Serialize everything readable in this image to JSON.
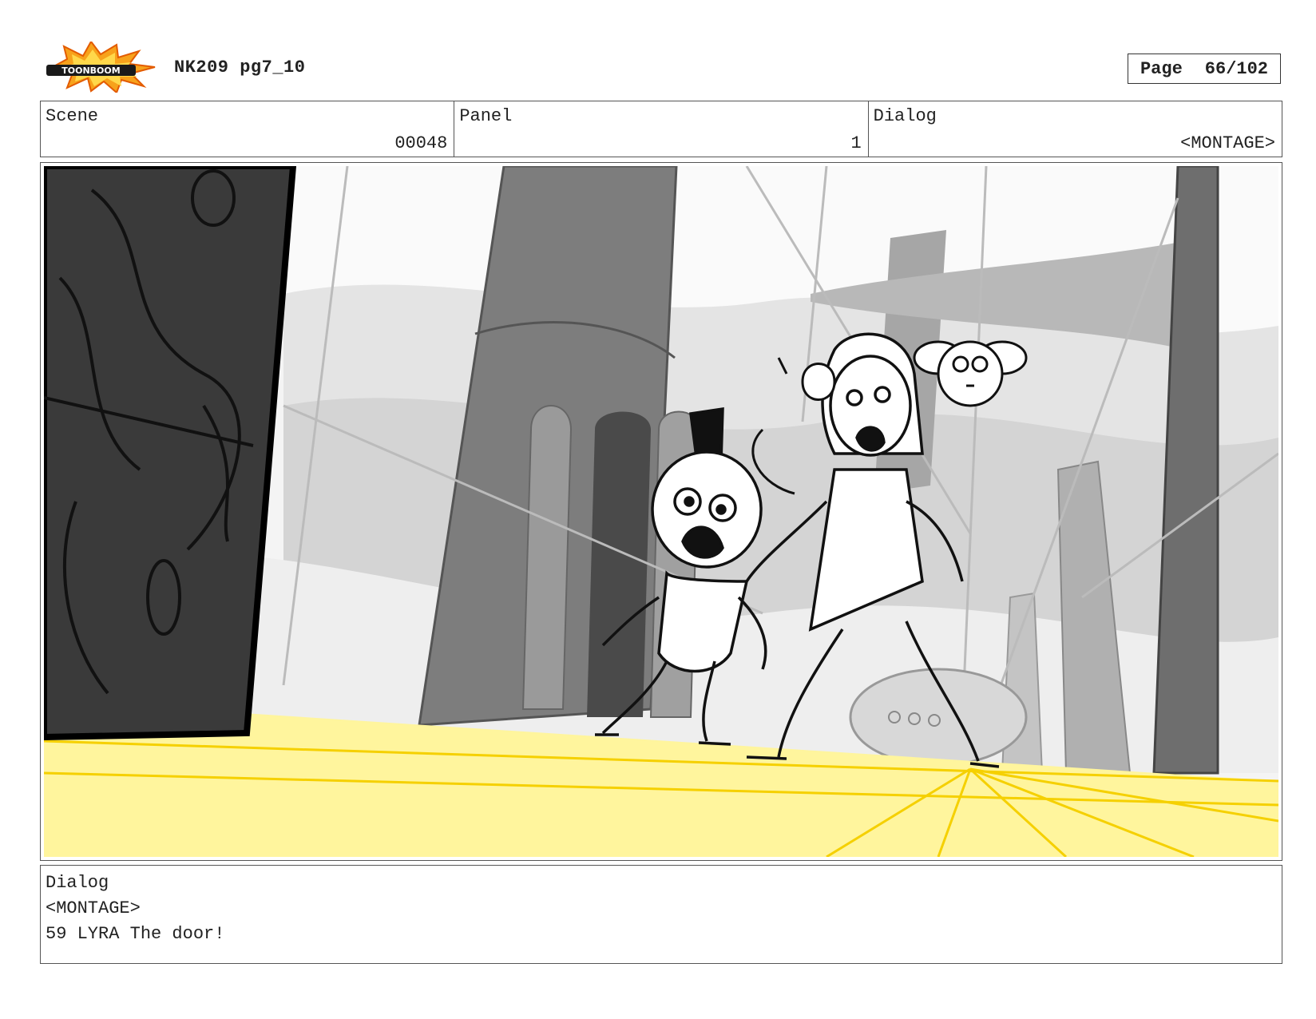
{
  "header": {
    "logo_text": "TOONBOOM",
    "title": "NK209 pg7_10",
    "page_label": "Page",
    "page_value": "66/102"
  },
  "info": {
    "scene_label": "Scene",
    "scene_value": "00048",
    "panel_label": "Panel",
    "panel_value": "1",
    "dialog_label": "Dialog",
    "dialog_value": "<MONTAGE>"
  },
  "dialog_box": {
    "label": "Dialog",
    "line1": "<MONTAGE>",
    "line2": "59 LYRA The door!"
  },
  "colors": {
    "floor_glow": "#fff59d",
    "floor_lines": "#f5d000",
    "door_dark": "#3a3a3a",
    "pillar_gray": "#7a7a7a",
    "fog_gray": "#d9d9d9"
  }
}
